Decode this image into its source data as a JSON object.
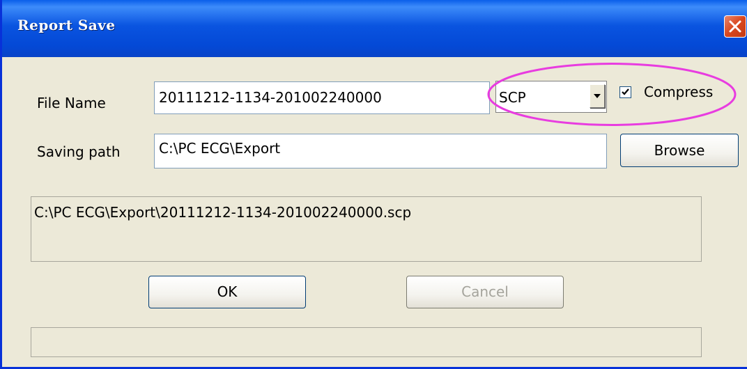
{
  "window": {
    "title": "Report Save",
    "close_icon": "close-icon"
  },
  "form": {
    "file_name_label": "File Name",
    "file_name_value": "20111212-1134-201002240000",
    "format_selected": "SCP",
    "compress_label": "Compress",
    "compress_checked": true,
    "saving_path_label": "Saving path",
    "saving_path_value": "C:\\PC ECG\\Export",
    "browse_label": "Browse",
    "full_path": "C:\\PC ECG\\Export\\20111212-1134-201002240000.scp",
    "status_text": ""
  },
  "buttons": {
    "ok_label": "OK",
    "cancel_label": "Cancel",
    "cancel_enabled": false
  },
  "colors": {
    "titlebar": "#0A54E0",
    "dialog_bg": "#ECE9D8",
    "highlight": "#E83CE0",
    "close_button": "#D9471E"
  }
}
